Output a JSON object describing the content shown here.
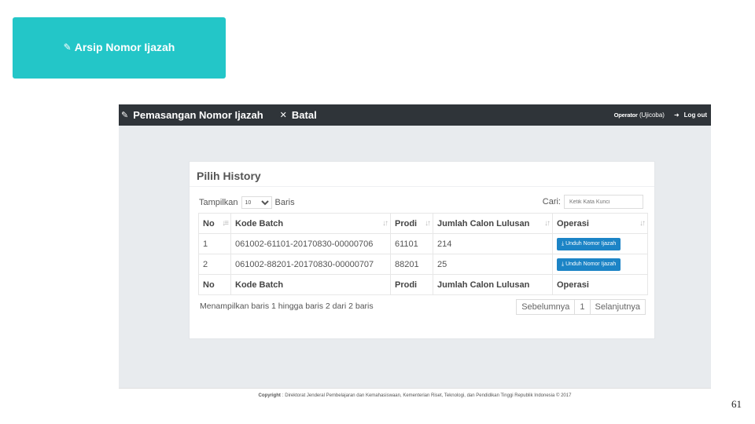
{
  "slide": {
    "title": "Arsip Nomor Ijazah",
    "page_number": "61",
    "title_color": "#23c6c8"
  },
  "topbar": {
    "nav_primary": "Pemasangan Nomor Ijazah",
    "nav_cancel": "Batal",
    "user_name": "Operator",
    "user_suffix": "(Ujicoba)",
    "logout_label": "Log out"
  },
  "panel": {
    "title": "Pilih History",
    "length_label_pre": "Tampilkan",
    "length_value": "10",
    "length_label_post": "Baris",
    "search_label": "Cari:",
    "search_placeholder": "Ketik Kata Kunci",
    "columns": [
      "No",
      "Kode Batch",
      "Prodi",
      "Jumlah Calon Lulusan",
      "Operasi"
    ],
    "rows": [
      {
        "no": "1",
        "kode_batch": "061002-61101-20170830-00000706",
        "prodi": "61101",
        "jumlah": "214",
        "action": "Unduh Nomor Ijazah"
      },
      {
        "no": "2",
        "kode_batch": "061002-88201-20170830-00000707",
        "prodi": "88201",
        "jumlah": "25",
        "action": "Unduh Nomor Ijazah"
      }
    ],
    "info": "Menampilkan baris 1 hingga baris 2 dari 2 baris",
    "pager": {
      "prev": "Sebelumnya",
      "current": "1",
      "next": "Selanjutnya"
    }
  },
  "footer": {
    "label": "Copyright",
    "text": "Direktorat Jenderal Pembelajaran dan Kemahasiswaan, Kementerian Riset, Teknologi, dan Pendidikan Tinggi Republik Indonesia © 2017"
  },
  "colors": {
    "accent": "#23c6c8",
    "topbar": "#2f3439",
    "button": "#1c84c6"
  }
}
